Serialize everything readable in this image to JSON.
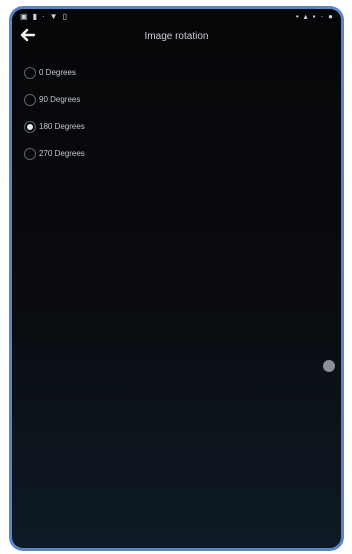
{
  "statusbar": {
    "left_icons": [
      "photo-icon",
      "download-icon",
      "dots-icon",
      "wifi-icon",
      "notification-icon"
    ],
    "right_icons": [
      "vibrate-icon",
      "alarm-icon",
      "battery-icon",
      "dots-icon",
      "circle-icon"
    ]
  },
  "header": {
    "title": "Image rotation"
  },
  "options": [
    {
      "label": "0 Degrees",
      "selected": false
    },
    {
      "label": "90 Degrees",
      "selected": false
    },
    {
      "label": "180 Degrees",
      "selected": true
    },
    {
      "label": "270 Degrees",
      "selected": false
    }
  ],
  "colors": {
    "frame": "#5a86c8",
    "background_top": "#050608",
    "background_bottom": "#0e1a26",
    "text": "#c2c6cc"
  }
}
